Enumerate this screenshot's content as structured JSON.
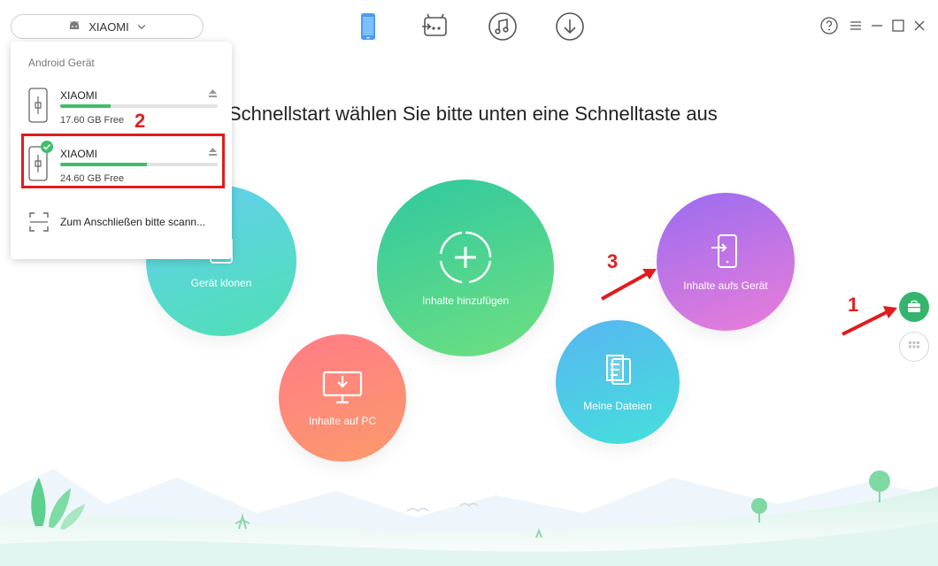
{
  "device_selector": {
    "label": "XIAOMI"
  },
  "heading": "Schnellstart wählen Sie bitte unten eine Schnelltaste aus",
  "panel": {
    "title": "Android Gerät",
    "devices": [
      {
        "name": "XIAOMI",
        "free": "17.60 GB Free",
        "used_fraction": 0.32
      },
      {
        "name": "XIAOMI",
        "free": "24.60 GB Free",
        "used_fraction": 0.55
      }
    ],
    "scan_label": "Zum Anschließen bitte scann..."
  },
  "actions": {
    "clone": "Gerät klonen",
    "add": "Inhalte hinzufügen",
    "to_device": "Inhalte aufs Gerät",
    "to_pc": "Inhalte auf PC",
    "files": "Meine Dateien"
  },
  "annotations": {
    "n1": "1",
    "n2": "2",
    "n3": "3"
  },
  "colors": {
    "accent": "#35b46e",
    "annotation": "#e21b1b"
  },
  "icons": {
    "toolbar": [
      "phone-icon",
      "android-transfer-icon",
      "music-icon",
      "download-icon"
    ],
    "window": [
      "help-icon",
      "menu-icon",
      "minimize-icon",
      "maximize-icon",
      "close-icon"
    ]
  }
}
